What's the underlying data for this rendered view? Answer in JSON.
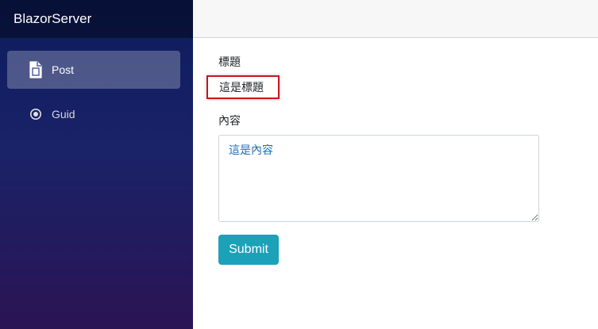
{
  "app": {
    "brand": "BlazorServer"
  },
  "sidebar": {
    "items": [
      {
        "label": "Post",
        "icon": "document-icon",
        "active": true
      },
      {
        "label": "Guid",
        "icon": "radio-circle-icon",
        "active": false
      }
    ]
  },
  "form": {
    "title_label": "標題",
    "title_value": "這是標題",
    "content_label": "內容",
    "content_value": "這是內容",
    "submit_label": "Submit"
  },
  "colors": {
    "accent_button": "#1ba1b8",
    "highlight_border": "#c8161d",
    "content_text": "#1b6ec2"
  }
}
